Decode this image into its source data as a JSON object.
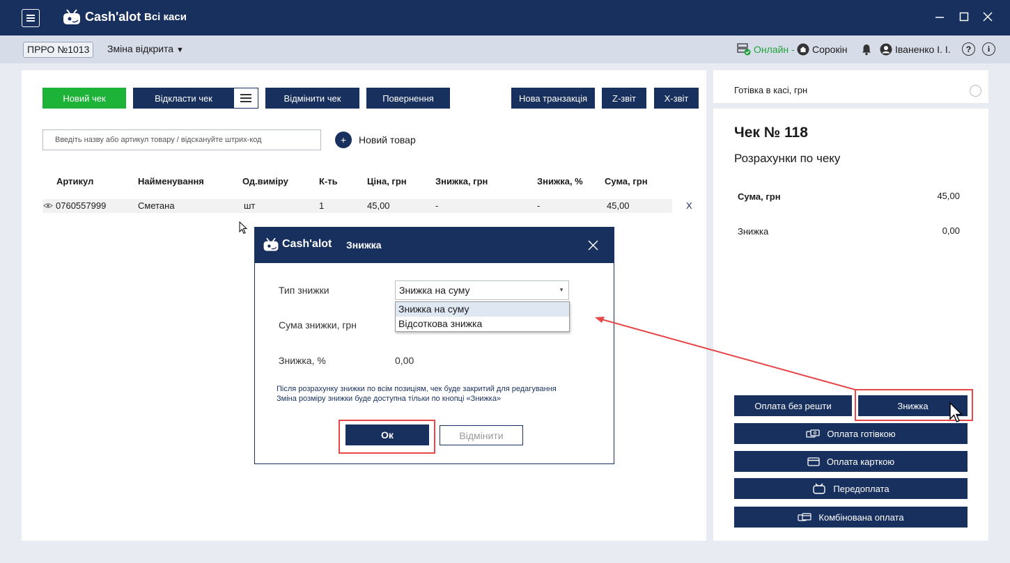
{
  "app": {
    "logo_text": "Cash'alot",
    "title": "Всі каси"
  },
  "subheader": {
    "prro": "ПРРО №1013",
    "shift": "Зміна відкрита",
    "status": "Онлайн",
    "location": "Сорокін",
    "user": "Іваненко І. І."
  },
  "toolbar": {
    "new_check": "Новий чек",
    "postpone": "Відкласти чек",
    "cancel_check": "Відмінити чек",
    "return": "Повернення",
    "new_transaction": "Нова транзакція",
    "z_report": "Z-звіт",
    "x_report": "X-звіт"
  },
  "search": {
    "placeholder": "Введіть назву або артикул товару / відскануйте штрих-код",
    "new_product": "Новий товар"
  },
  "table": {
    "headers": [
      "Артикул",
      "Найменування",
      "Од.виміру",
      "К-ть",
      "Ціна, грн",
      "Знижка, грн",
      "Знижка, %",
      "Сума, грн"
    ],
    "rows": [
      [
        "0760557999",
        "Сметана",
        "шт",
        "1",
        "45,00",
        "-",
        "-",
        "45,00"
      ]
    ],
    "remove": "X"
  },
  "cash": {
    "label": "Готівка в касі, грн"
  },
  "receipt": {
    "title": "Чек № 118",
    "subtitle": "Розрахунки по чеку",
    "sum_label": "Сума, грн",
    "sum_value": "45,00",
    "discount_label": "Знижка",
    "discount_value": "0,00",
    "buttons": {
      "no_change": "Оплата без решти",
      "discount": "Знижка",
      "cash": "Оплата готівкою",
      "card": "Оплата карткою",
      "prepay": "Передоплата",
      "combined": "Комбінована оплата"
    }
  },
  "dialog": {
    "logo_text": "Cash'alot",
    "title": "Знижка",
    "type_label": "Тип знижки",
    "type_value": "Знижка на суму",
    "options": [
      "Знижка на суму",
      "Відсоткова знижка"
    ],
    "sum_label": "Сума знижки, грн",
    "pct_label": "Знижка, %",
    "pct_value": "0,00",
    "note_line1": "Після розрахунку знижки по всім позиціям, чек буде закритий для редагування",
    "note_line2": "Зміна розміру знижки буде доступна тільки по кнопці «Знижка»",
    "ok": "Ок",
    "cancel": "Відмінити"
  },
  "colors": {
    "navy": "#18305e",
    "green": "#1db338",
    "highlight": "#e8474a"
  }
}
